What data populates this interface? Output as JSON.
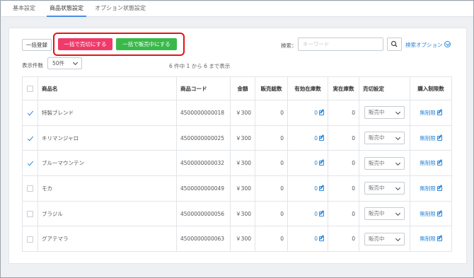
{
  "tabs": [
    "基本設定",
    "商品状態設定",
    "オプション状態設定"
  ],
  "toolbar": {
    "bulk_register": "一括登録",
    "bulk_sold_out": "一括で売切にする",
    "bulk_on_sale": "一括で販売中にする",
    "search_label": "検索：",
    "search_placeholder": "キーワード",
    "search_options": "検索オプション"
  },
  "list": {
    "count_label": "表示件数",
    "page_size": "50件",
    "showing": "6 件中 1 から 6 まで表示"
  },
  "table": {
    "headers": [
      "商品名",
      "商品コード",
      "金額",
      "販売総数",
      "有効在庫数",
      "実在庫数",
      "売切設定",
      "購入制限数"
    ],
    "rows": [
      {
        "checked": true,
        "name": "特製ブレンド",
        "code": "4500000000018",
        "price": "￥300",
        "sold": "0",
        "available": "0",
        "actual": "0",
        "status": "販売中",
        "limit": "無制限"
      },
      {
        "checked": true,
        "name": "キリマンジャロ",
        "code": "4500000000025",
        "price": "￥300",
        "sold": "0",
        "available": "0",
        "actual": "0",
        "status": "販売中",
        "limit": "無制限"
      },
      {
        "checked": true,
        "name": "ブルーマウンテン",
        "code": "4500000000032",
        "price": "￥300",
        "sold": "0",
        "available": "0",
        "actual": "0",
        "status": "販売中",
        "limit": "無制限"
      },
      {
        "checked": false,
        "name": "モカ",
        "code": "4500000000049",
        "price": "￥300",
        "sold": "0",
        "available": "0",
        "actual": "0",
        "status": "販売中",
        "limit": "無制限"
      },
      {
        "checked": false,
        "name": "ブラジル",
        "code": "4500000000056",
        "price": "￥300",
        "sold": "0",
        "available": "0",
        "actual": "0",
        "status": "販売中",
        "limit": "無制限"
      },
      {
        "checked": false,
        "name": "グアテマラ",
        "code": "4500000000063",
        "price": "￥300",
        "sold": "0",
        "available": "0",
        "actual": "0",
        "status": "販売中",
        "limit": "無制限"
      }
    ]
  },
  "colors": {
    "accent": "#2a86d9",
    "pink": "#f03a6a",
    "green": "#3ab94a",
    "highlight": "#e51414"
  }
}
